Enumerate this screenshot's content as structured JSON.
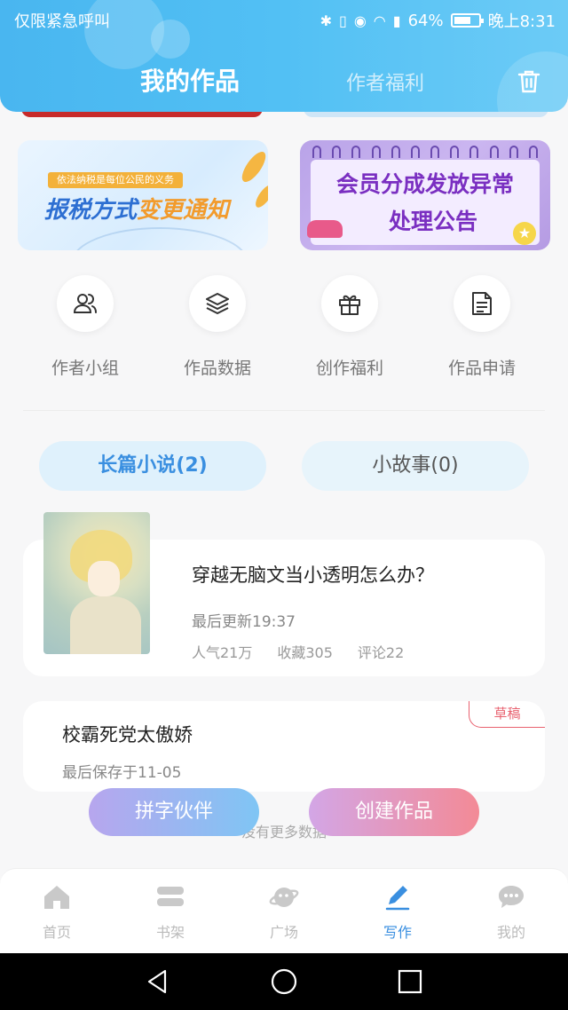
{
  "status_bar": {
    "left_text": "仅限紧急呼叫",
    "battery": "64%",
    "time": "晚上8:31"
  },
  "header": {
    "tab_active": "我的作品",
    "tab_inactive": "作者福利"
  },
  "banners": {
    "tax_tag": "依法纳税是每位公民的义务",
    "tax_title_a": "报税方式",
    "tax_title_b": "变更通知",
    "vip_line1": "会员分成发放异常",
    "vip_line2": "处理公告"
  },
  "quick_actions": [
    {
      "label": "作者小组",
      "icon": "group-icon"
    },
    {
      "label": "作品数据",
      "icon": "layers-icon"
    },
    {
      "label": "创作福利",
      "icon": "gift-icon"
    },
    {
      "label": "作品申请",
      "icon": "document-icon"
    }
  ],
  "categories": {
    "novel": "长篇小说(2)",
    "story": "小故事(0)"
  },
  "works": [
    {
      "title": "穿越无脑文当小透明怎么办？",
      "updated": "最后更新19:37",
      "popularity": "人气21万",
      "favorites": "收藏305",
      "comments": "评论22"
    },
    {
      "badge": "草稿",
      "title": "校霸死党太傲娇",
      "saved": "最后保存于11-05"
    }
  ],
  "no_more": "没有更多数据",
  "fab": {
    "partner": "拼字伙伴",
    "create": "创建作品"
  },
  "bottom_nav": [
    {
      "label": "首页",
      "icon": "home-icon"
    },
    {
      "label": "书架",
      "icon": "bookshelf-icon"
    },
    {
      "label": "广场",
      "icon": "planet-icon"
    },
    {
      "label": "写作",
      "icon": "pen-icon",
      "active": true
    },
    {
      "label": "我的",
      "icon": "chat-icon"
    }
  ],
  "colors": {
    "header_blue": "#52c0f4",
    "accent_blue": "#3a8fe0",
    "draft_red": "#e8616f"
  }
}
